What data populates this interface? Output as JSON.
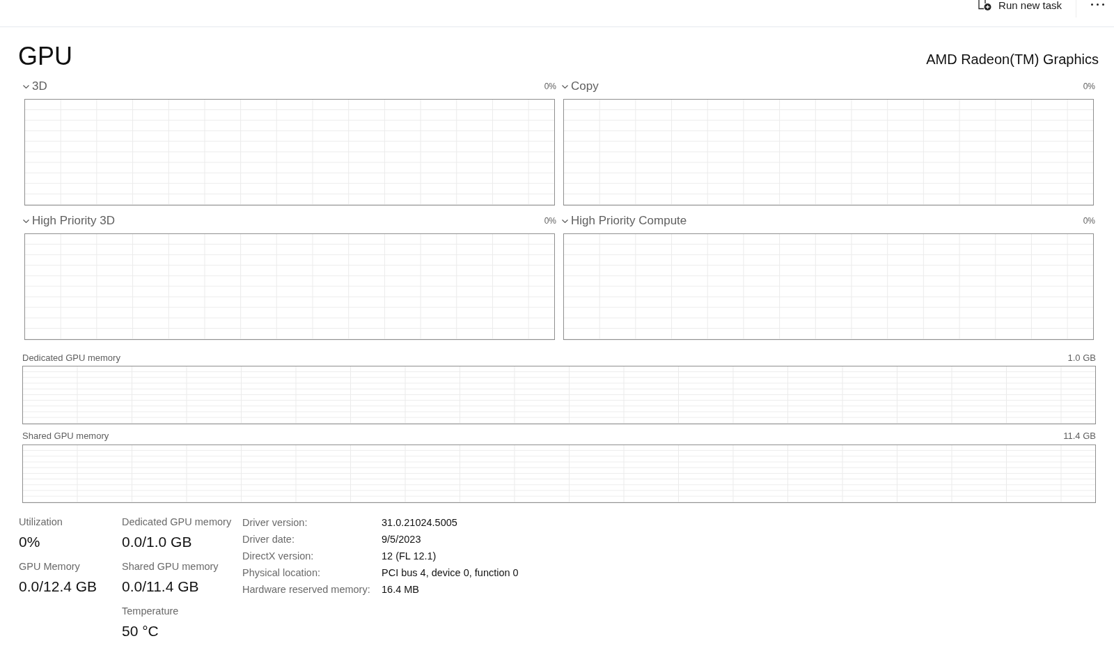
{
  "toolbar": {
    "run_task_label": "Run new task"
  },
  "header": {
    "title": "GPU",
    "device_name": "AMD Radeon(TM) Graphics"
  },
  "engine_graphs": [
    {
      "label": "3D",
      "reading": "0%"
    },
    {
      "label": "Copy",
      "reading": "0%"
    },
    {
      "label": "High Priority 3D",
      "reading": "0%"
    },
    {
      "label": "High Priority Compute",
      "reading": "0%"
    }
  ],
  "memory_graphs": [
    {
      "label": "Dedicated GPU memory",
      "maximum": "1.0 GB"
    },
    {
      "label": "Shared GPU memory",
      "maximum": "11.4 GB"
    }
  ],
  "stat_columns": [
    [
      {
        "label": "Utilization",
        "value": "0%"
      },
      {
        "label": "GPU Memory",
        "value": "0.0/12.4 GB"
      }
    ],
    [
      {
        "label": "Dedicated GPU memory",
        "value": "0.0/1.0 GB"
      },
      {
        "label": "Shared GPU memory",
        "value": "0.0/11.4 GB"
      },
      {
        "label": "Temperature",
        "value": "50 °C"
      }
    ]
  ],
  "details": [
    {
      "label": "Driver version:",
      "value": "31.0.21024.5005"
    },
    {
      "label": "Driver date:",
      "value": "9/5/2023"
    },
    {
      "label": "DirectX version:",
      "value": "12 (FL 12.1)"
    },
    {
      "label": "Physical location:",
      "value": "PCI bus 4, device 0, function 0"
    },
    {
      "label": "Hardware reserved memory:",
      "value": "16.4 MB"
    }
  ]
}
